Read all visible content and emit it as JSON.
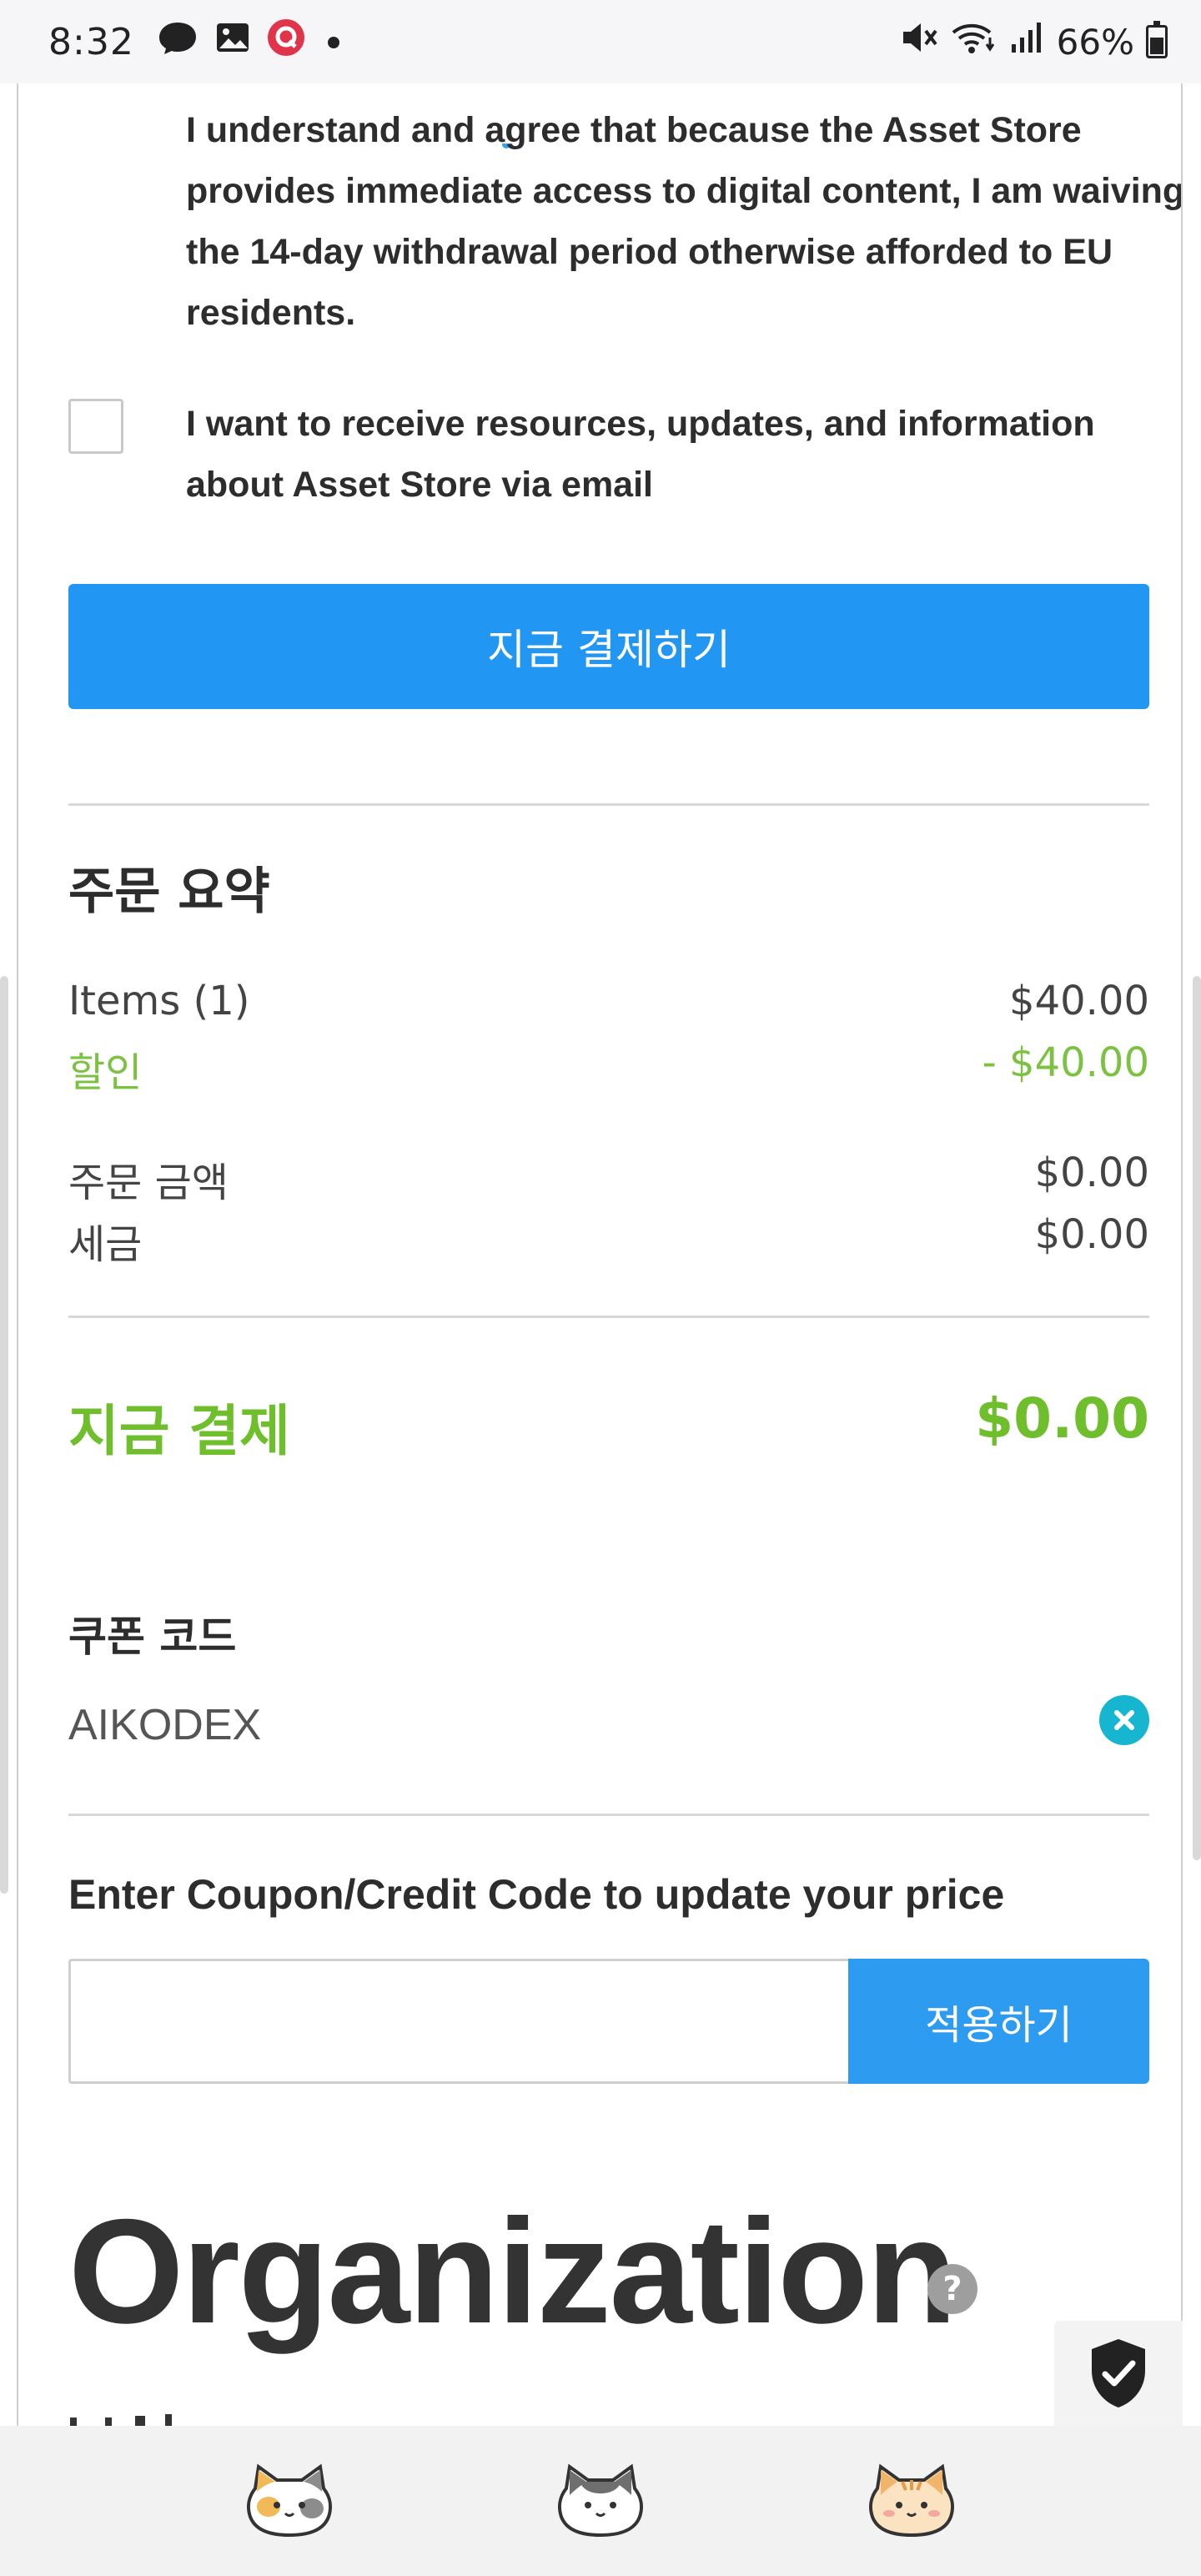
{
  "status_bar": {
    "time": "8:32",
    "battery": "66%"
  },
  "consent": {
    "agree_text": "I understand and agree that because the Asset Store provides immediate access to digital content, I am waiving the 14-day withdrawal period otherwise afforded to EU residents.",
    "email_opt_in_label": "I want to receive resources, updates, and information about Asset Store via email"
  },
  "pay_button_label": "지금 결제하기",
  "summary": {
    "title": "주문 요약",
    "items_label": "Items (1)",
    "items_value": "$40.00",
    "discount_label": "할인",
    "discount_value": "- $40.00",
    "order_amount_label": "주문 금액",
    "order_amount_value": "$0.00",
    "tax_label": "세금",
    "tax_value": "$0.00",
    "total_label": "지금 결제",
    "total_value": "$0.00"
  },
  "coupon": {
    "title": "쿠폰 코드",
    "applied_code": "AIKODEX",
    "prompt": "Enter Coupon/Credit Code to update your price",
    "input_value": "",
    "apply_label": "적용하기"
  },
  "organization": {
    "heading": "Organization",
    "help_glyph": "?"
  },
  "colors": {
    "primary_blue": "#2196f3",
    "green": "#7cc142",
    "coupon_remove": "#17b6d0"
  },
  "icons": {
    "status_left": [
      "messenger-icon",
      "gallery-icon",
      "app-notification-icon",
      "dot-icon"
    ],
    "status_right": [
      "mute-icon",
      "wifi-icon",
      "signal-icon",
      "battery-icon"
    ],
    "bottom_nav": [
      "calico-cat-icon",
      "gray-cat-icon",
      "orange-cat-icon"
    ],
    "widget": "shield-check-icon"
  }
}
